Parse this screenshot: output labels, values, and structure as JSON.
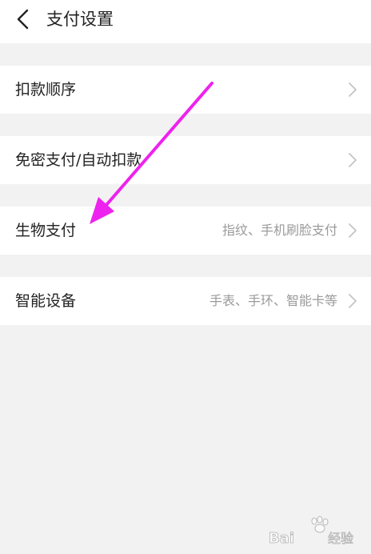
{
  "header": {
    "title": "支付设置",
    "back_icon": "chevron-left-icon"
  },
  "rows": [
    {
      "label": "扣款顺序",
      "hint": ""
    },
    {
      "label": "免密支付/自动扣款",
      "hint": ""
    },
    {
      "label": "生物支付",
      "hint": "指纹、手机刷脸支付"
    },
    {
      "label": "智能设备",
      "hint": "手表、手环、智能卡等"
    }
  ],
  "annotation": {
    "type": "arrow",
    "color": "#ee22ee",
    "points_to": "生物支付"
  },
  "watermark": {
    "brand_part1": "Bai",
    "brand_part2": "经验",
    "icon": "paw-icon"
  },
  "colors": {
    "background": "#f2f2f2",
    "card": "#ffffff",
    "text": "#222222",
    "hint": "#9a9a9a",
    "chevron": "#c4c4c4"
  }
}
